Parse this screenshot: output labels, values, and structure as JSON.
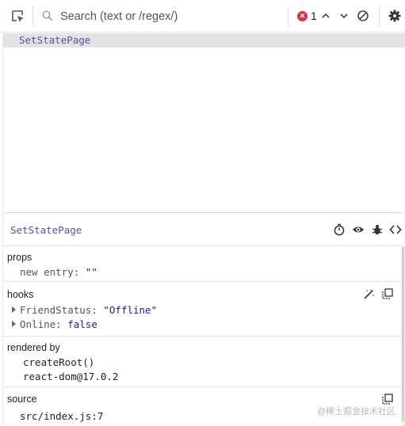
{
  "toolbar": {
    "search_placeholder": "Search (text or /regex/)",
    "error_count": "1",
    "icons": [
      "select-element-icon",
      "search-icon",
      "error-icon",
      "chevron-up-icon",
      "chevron-down-icon",
      "clear-icon",
      "gear-icon"
    ]
  },
  "tree": {
    "selected_component": "SetStatePage"
  },
  "inspector": {
    "component_name": "SetStatePage",
    "header_icons": [
      "stopwatch-icon",
      "eye-icon",
      "bug-icon",
      "code-icon"
    ],
    "props": {
      "title": "props",
      "items": [
        {
          "key": "new entry",
          "value": "\"\""
        }
      ]
    },
    "hooks": {
      "title": "hooks",
      "items": [
        {
          "key": "FriendStatus",
          "value": "\"Offline\""
        },
        {
          "key": "Online",
          "value": "false"
        }
      ]
    },
    "rendered_by": {
      "title": "rendered by",
      "items": [
        "createRoot()",
        "react-dom@17.0.2"
      ]
    },
    "source": {
      "title": "source",
      "value": "src/index.js:7"
    }
  },
  "watermark": "@稀土掘金技术社区",
  "colors": {
    "component": "#5b4fa8",
    "value": "#1a1aa6",
    "error": "#e0303e",
    "selected_row": "#e3e3e3"
  }
}
